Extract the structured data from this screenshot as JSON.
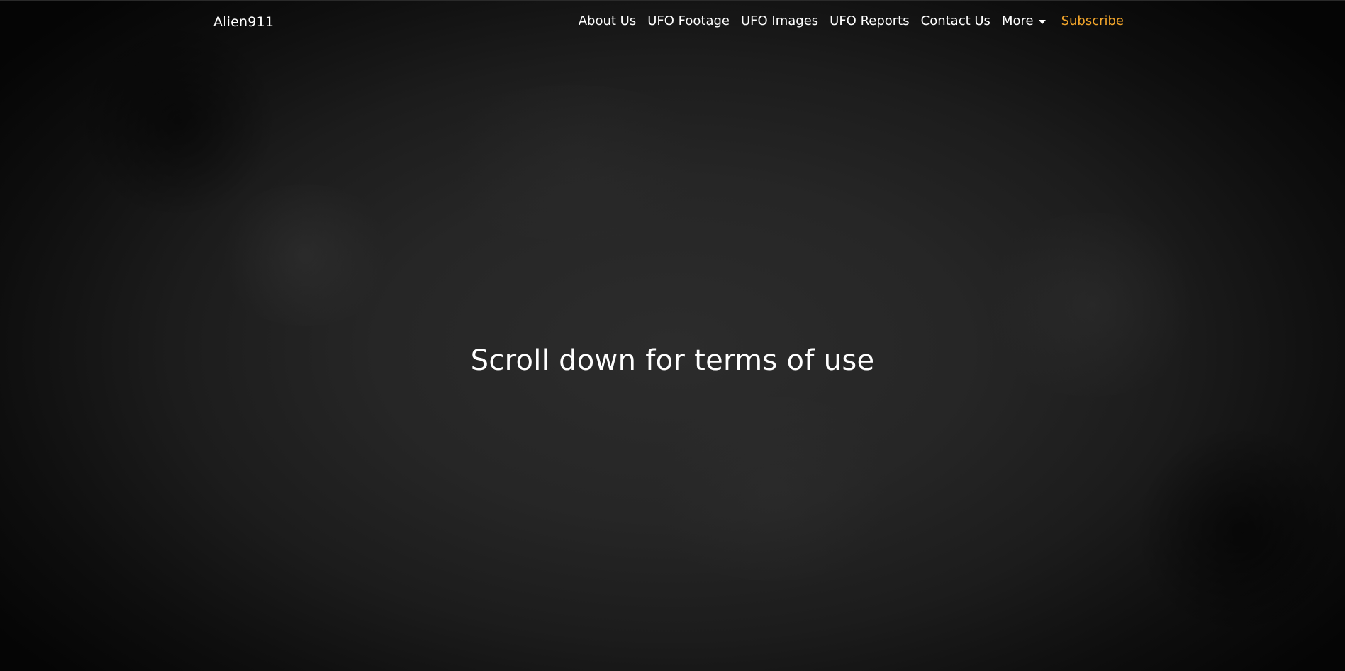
{
  "brand": {
    "name": "Alien911"
  },
  "nav": {
    "items": [
      {
        "label": "About Us"
      },
      {
        "label": "UFO Footage"
      },
      {
        "label": "UFO Images"
      },
      {
        "label": "UFO Reports"
      },
      {
        "label": "Contact Us"
      },
      {
        "label": "More"
      }
    ],
    "subscribe_label": "Subscribe",
    "subscribe_color": "#f2a52b"
  },
  "hero": {
    "title": "Scroll down for terms of use"
  },
  "icons": {
    "more_dropdown": "caret-down-icon"
  }
}
